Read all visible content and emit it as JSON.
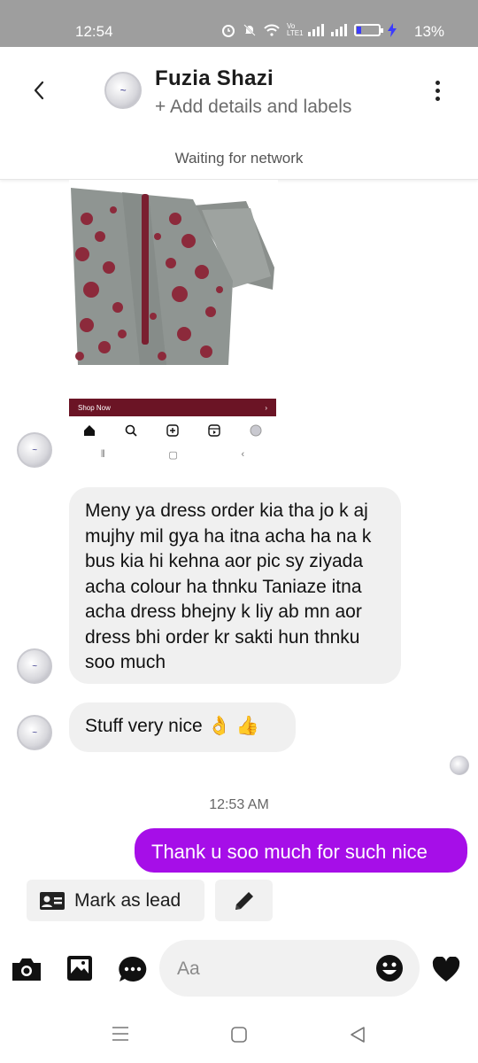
{
  "status_bar": {
    "time": "12:54",
    "network_label": "Vo LTE1",
    "battery": "13%"
  },
  "header": {
    "contact_name": "Fuzia Shazi",
    "add_details": "+ Add details and labels",
    "network_status": "Waiting for network"
  },
  "shared_image": {
    "shop_now": "Shop Now",
    "shop_arrow": "›"
  },
  "messages": [
    {
      "direction": "incoming",
      "text": "Meny ya dress order kia tha jo k aj mujhy mil gya ha itna acha ha na k bus kia hi kehna aor pic sy ziyada acha colour ha thnku Taniaze itna acha dress bhejny k liy ab mn aor dress bhi order kr sakti hun thnku soo much"
    },
    {
      "direction": "incoming",
      "text": "Stuff very nice 👌 👍"
    },
    {
      "direction": "outgoing",
      "text": "Thank u soo much for such nice"
    }
  ],
  "timestamp": "12:53 AM",
  "actions": {
    "mark_as_lead": "Mark as lead"
  },
  "composer": {
    "placeholder": "Aa"
  },
  "colors": {
    "outgoing_bubble": "#a60ee8",
    "incoming_bubble": "#f0f0f0",
    "status_bar": "#9e9e9e"
  },
  "icons": [
    "back-arrow-icon",
    "more-vert-icon",
    "camera-icon",
    "gallery-icon",
    "more-chat-icon",
    "emoji-icon",
    "heart-icon",
    "id-card-icon",
    "pencil-icon"
  ]
}
